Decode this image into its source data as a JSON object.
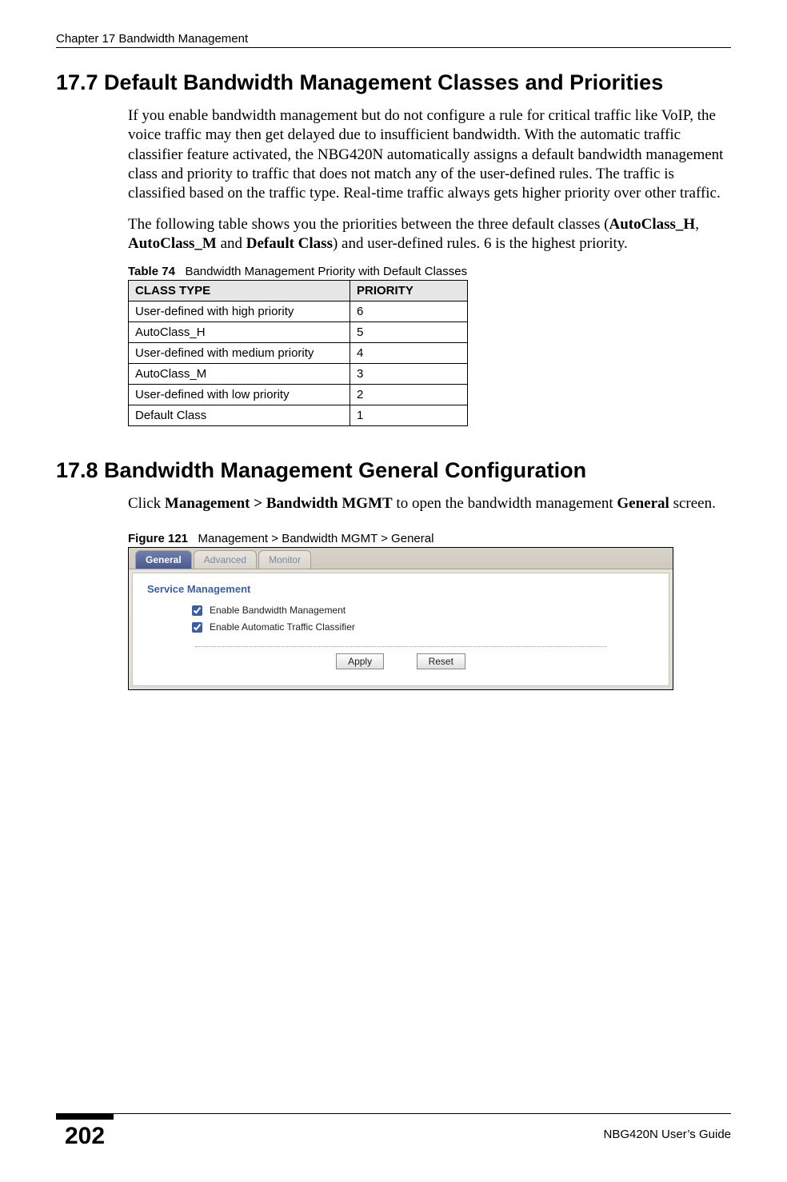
{
  "header": {
    "chapter": "Chapter 17 Bandwidth Management"
  },
  "s17_7": {
    "heading": "17.7  Default Bandwidth Management Classes and Priorities",
    "para1": "If you enable bandwidth management but do not configure a rule for critical traffic like VoIP, the voice traffic may then get delayed due to insufficient bandwidth. With the automatic traffic classifier feature activated, the NBG420N automatically assigns a default bandwidth management class and priority to traffic that does not match any of the user-defined rules. The traffic is classified based on the traffic type. Real-time traffic always gets higher priority over other traffic.",
    "para2_a": "The following table shows you the priorities between the three default classes (",
    "para2_b1": "AutoClass_H",
    "para2_c": ", ",
    "para2_b2": "AutoClass_M",
    "para2_d": " and ",
    "para2_b3": "Default Class",
    "para2_e": ") and user-defined rules. 6 is the highest priority."
  },
  "table74": {
    "caption_label": "Table 74",
    "caption_text": "Bandwidth Management Priority with Default Classes",
    "head_col1": "CLASS TYPE",
    "head_col2": "PRIORITY",
    "rows": [
      {
        "c1": "User-defined with high priority",
        "c2": "6"
      },
      {
        "c1": "AutoClass_H",
        "c2": "5"
      },
      {
        "c1": "User-defined with medium priority",
        "c2": "4"
      },
      {
        "c1": "AutoClass_M",
        "c2": "3"
      },
      {
        "c1": "User-defined with low priority",
        "c2": "2"
      },
      {
        "c1": "Default Class",
        "c2": "1"
      }
    ]
  },
  "s17_8": {
    "heading": "17.8  Bandwidth Management General Configuration",
    "para_a": "Click ",
    "para_b1": "Management > Bandwidth MGMT",
    "para_c": " to open the bandwidth management ",
    "para_b2": "General",
    "para_d": " screen."
  },
  "figure121": {
    "caption_label": "Figure 121",
    "caption_text": "Management > Bandwidth MGMT > General"
  },
  "screenshot": {
    "tabs": {
      "general": "General",
      "advanced": "Advanced",
      "monitor": "Monitor"
    },
    "section_label": "Service Management",
    "cb1": "Enable Bandwidth Management",
    "cb2": "Enable Automatic Traffic Classifier",
    "apply": "Apply",
    "reset": "Reset"
  },
  "footer": {
    "page": "202",
    "guide": "NBG420N User’s Guide"
  }
}
